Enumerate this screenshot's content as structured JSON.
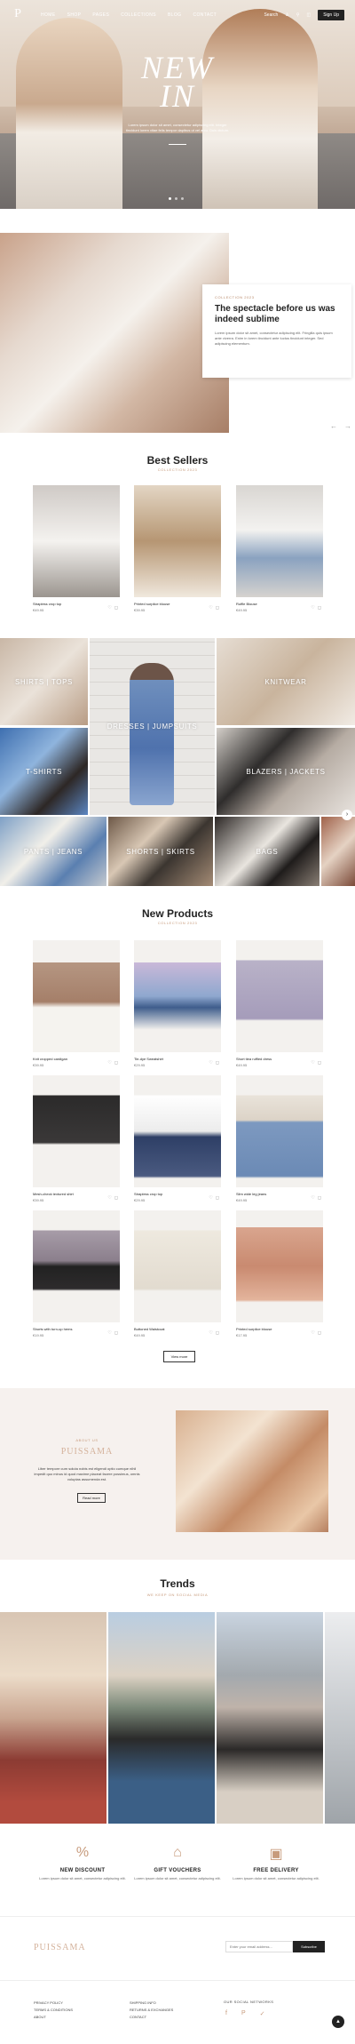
{
  "nav": {
    "logo": "P",
    "links": [
      "HOME",
      "SHOP",
      "PAGES",
      "COLLECTIONS",
      "BLOG",
      "CONTACT"
    ],
    "search": "Search",
    "signup": "Sign Up"
  },
  "hero": {
    "title_line1": "NEW",
    "title_line2": "IN",
    "subtitle": "Lorem ipsum dolor sit amet, consectetur adipiscing elit. Integer tincidunt lorem vitae felis tempor dapibus ut vel arcu. Duis dictum."
  },
  "collection": {
    "eyebrow": "COLLECTION 2023",
    "title": "The spectacle before us was indeed sublime",
    "text": "Lorem ipsum dolor sit amet, consectetur adipiscing elit. Fringilla quis ipsum ante viverra. Enim in lorem tincidunt ante luctus tincidunt integer. Sed adipiscing elementum."
  },
  "best_sellers": {
    "title": "Best Sellers",
    "subtitle": "COLLECTION 2023",
    "items": [
      {
        "name": "Strapless crop top",
        "price": "€49.95"
      },
      {
        "name": "Printed surplice blouse",
        "price": "€39.95"
      },
      {
        "name": "Ruffle Blouse",
        "price": "€49.95"
      }
    ]
  },
  "categories": [
    "SHIRTS | TOPS",
    "DRESSES | JUMPSUITS",
    "KNITWEAR",
    "T-SHIRTS",
    "BLAZERS | JACKETS",
    "PANTS | JEANS",
    "SHORTS | SKIRTS",
    "BAGS"
  ],
  "new_products": {
    "title": "New Products",
    "subtitle": "COLLECTION 2023",
    "items": [
      {
        "name": "Knit cropped cardigan",
        "price": "€39.95"
      },
      {
        "name": "Tie-dye Sweatshirt",
        "price": "€29.95"
      },
      {
        "name": "Short tiea ruffled dress",
        "price": "€49.95"
      },
      {
        "name": "Mesh-check textured shirt",
        "price": "€39.95"
      },
      {
        "name": "Strapless crop top",
        "price": "€29.95"
      },
      {
        "name": "Slim wide leg jeans",
        "price": "€49.95"
      },
      {
        "name": "Shorts with turn-up hems",
        "price": "€19.95"
      },
      {
        "name": "Buttoned Waistcoat",
        "price": "€49.95"
      },
      {
        "name": "Printed surplice blouse",
        "price": "€17.95"
      }
    ],
    "view_more": "View more"
  },
  "about": {
    "eyebrow": "ABOUT US",
    "brand": "PUISSAMA",
    "text": "Liber tempore cum soluta nobis est eligendi optio cumque nihil impedit quo minus id quod maxime placeat facere possimus, omnis voluptas assumenda est.",
    "button": "Read more"
  },
  "trends": {
    "title": "Trends",
    "subtitle": "WE KEEP ON SOCIAL MEDIA"
  },
  "features": [
    {
      "icon": "discount-icon",
      "title": "NEW DISCOUNT",
      "text": "Lorem ipsum dolor sit amet, consectetur adipiscing elit."
    },
    {
      "icon": "gift-icon",
      "title": "GIFT VOUCHERS",
      "text": "Lorem ipsum dolor sit amet, consectetur adipiscing elit."
    },
    {
      "icon": "delivery-icon",
      "title": "FREE DELIVERY",
      "text": "Lorem ipsum dolor sit amet, consectetur adipiscing elit."
    }
  ],
  "newsletter": {
    "brand": "PUISSAMA",
    "placeholder": "Enter your email address...",
    "button": "Subscribe"
  },
  "footer": {
    "col1": [
      "PRIVACY POLICY",
      "TERMS & CONDITIONS",
      "ABOUT"
    ],
    "col2": [
      "SHIPPING INFO",
      "RETURNS & EXCHANGES",
      "CONTACT"
    ],
    "social_title": "OUR SOCIAL NETWORKS"
  },
  "colors": {
    "accent": "#c79b7c",
    "dark": "#222222"
  }
}
